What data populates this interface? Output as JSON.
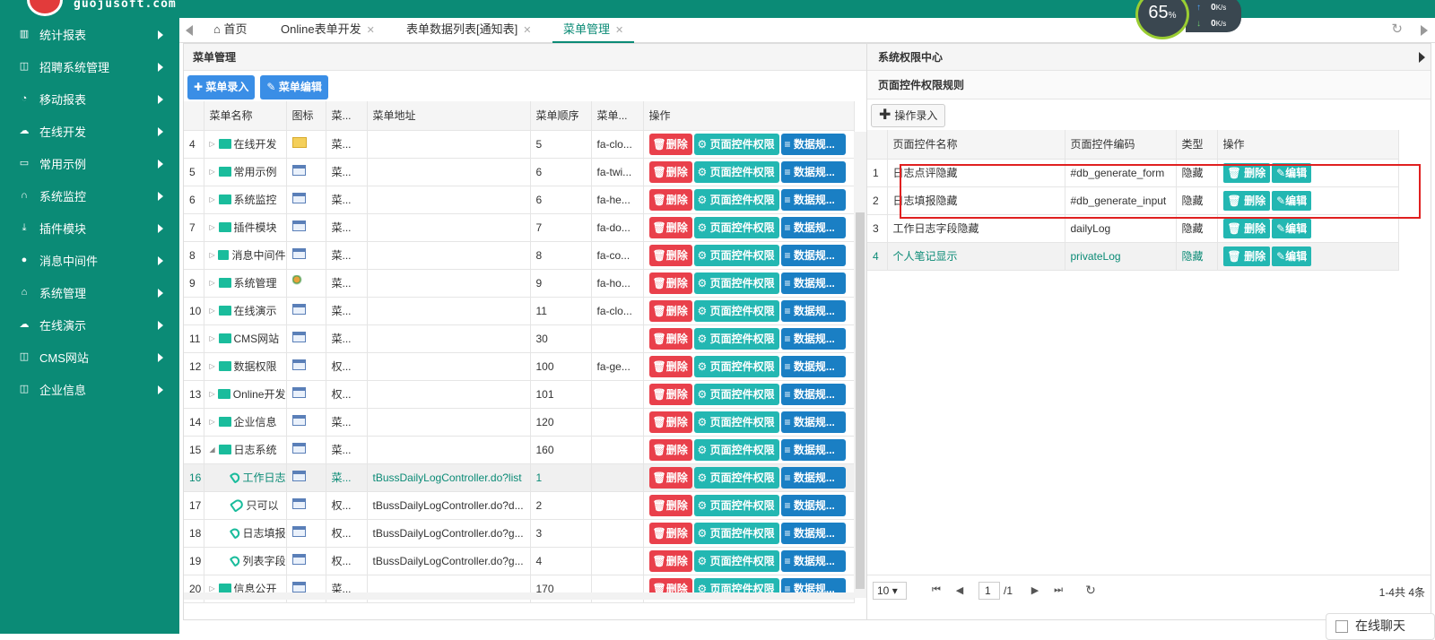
{
  "brand": {
    "logo_text": "guojusoft.com"
  },
  "sidebar": {
    "items": [
      {
        "label": "统计报表",
        "icon": "bar-chart-icon",
        "glyph": "▥"
      },
      {
        "label": "招聘系统管理",
        "icon": "columns-icon",
        "glyph": "◫"
      },
      {
        "label": "移动报表",
        "icon": "pie-chart-icon",
        "glyph": "◔"
      },
      {
        "label": "在线开发",
        "icon": "cloud-icon",
        "glyph": "☁"
      },
      {
        "label": "常用示例",
        "icon": "comment-icon",
        "glyph": "▭"
      },
      {
        "label": "系统监控",
        "icon": "headset-icon",
        "glyph": "∩"
      },
      {
        "label": "插件模块",
        "icon": "download-icon",
        "glyph": "⤓"
      },
      {
        "label": "消息中间件",
        "icon": "comments-icon",
        "glyph": "●"
      },
      {
        "label": "系统管理",
        "icon": "home-icon",
        "glyph": "⌂"
      },
      {
        "label": "在线演示",
        "icon": "cloud-icon",
        "glyph": "☁"
      },
      {
        "label": "CMS网站",
        "icon": "columns-icon",
        "glyph": "◫"
      },
      {
        "label": "企业信息",
        "icon": "columns-icon",
        "glyph": "◫"
      }
    ]
  },
  "monitor": {
    "percent": "65",
    "percent_unit": "%",
    "up_speed": "0",
    "down_speed": "0",
    "speed_unit": "K/s"
  },
  "tabs": [
    {
      "label": "首页",
      "closable": false
    },
    {
      "label": "Online表单开发",
      "closable": true
    },
    {
      "label": "表单数据列表[通知表]",
      "closable": true
    },
    {
      "label": "菜单管理",
      "closable": true,
      "active": true
    }
  ],
  "left_panel": {
    "title": "菜单管理",
    "add_button": "菜单录入",
    "edit_button": "菜单编辑",
    "columns": [
      "菜单名称",
      "图标",
      "菜...",
      "菜单地址",
      "菜单顺序",
      "菜单...",
      "操作"
    ],
    "delete_label": "删除",
    "perm_label": "页面控件权限",
    "data_label": "数据规...",
    "rows": [
      {
        "no": "4",
        "name": "在线开发",
        "level": 0,
        "expanded": false,
        "icon": "folder",
        "type": "菜...",
        "url": "",
        "order": "5",
        "fa": "fa-clo..."
      },
      {
        "no": "5",
        "name": "常用示例",
        "level": 0,
        "expanded": false,
        "icon": "grid",
        "type": "菜...",
        "url": "",
        "order": "6",
        "fa": "fa-twi..."
      },
      {
        "no": "6",
        "name": "系统监控",
        "level": 0,
        "expanded": false,
        "icon": "grid",
        "type": "菜...",
        "url": "",
        "order": "6",
        "fa": "fa-he..."
      },
      {
        "no": "7",
        "name": "插件模块",
        "level": 0,
        "expanded": false,
        "icon": "grid",
        "type": "菜...",
        "url": "",
        "order": "7",
        "fa": "fa-do..."
      },
      {
        "no": "8",
        "name": "消息中间件",
        "level": 0,
        "expanded": false,
        "icon": "grid",
        "type": "菜...",
        "url": "",
        "order": "8",
        "fa": "fa-co..."
      },
      {
        "no": "9",
        "name": "系统管理",
        "level": 0,
        "expanded": false,
        "icon": "users",
        "type": "菜...",
        "url": "",
        "order": "9",
        "fa": "fa-ho..."
      },
      {
        "no": "10",
        "name": "在线演示",
        "level": 0,
        "expanded": false,
        "icon": "grid",
        "type": "菜...",
        "url": "",
        "order": "11",
        "fa": "fa-clo..."
      },
      {
        "no": "11",
        "name": "CMS网站",
        "level": 0,
        "expanded": false,
        "icon": "grid",
        "type": "菜...",
        "url": "",
        "order": "30",
        "fa": ""
      },
      {
        "no": "12",
        "name": "数据权限",
        "level": 0,
        "expanded": false,
        "icon": "grid",
        "type": "权...",
        "url": "",
        "order": "100",
        "fa": "fa-ge..."
      },
      {
        "no": "13",
        "name": "Online开发",
        "level": 0,
        "expanded": false,
        "icon": "grid",
        "type": "权...",
        "url": "",
        "order": "101",
        "fa": ""
      },
      {
        "no": "14",
        "name": "企业信息",
        "level": 0,
        "expanded": false,
        "icon": "grid",
        "type": "菜...",
        "url": "",
        "order": "120",
        "fa": ""
      },
      {
        "no": "15",
        "name": "日志系统",
        "level": 0,
        "expanded": true,
        "icon": "grid",
        "type": "菜...",
        "url": "",
        "order": "160",
        "fa": ""
      },
      {
        "no": "16",
        "name": "工作日志",
        "level": 1,
        "expanded": false,
        "icon": "grid",
        "type": "菜...",
        "url": "tBussDailyLogController.do?list",
        "order": "1",
        "fa": "",
        "selected": true
      },
      {
        "no": "17",
        "name": "只可以",
        "level": 1,
        "expanded": false,
        "icon": "grid",
        "type": "权...",
        "url": "tBussDailyLogController.do?d...",
        "order": "2",
        "fa": ""
      },
      {
        "no": "18",
        "name": "日志填报",
        "level": 1,
        "expanded": false,
        "icon": "grid",
        "type": "权...",
        "url": "tBussDailyLogController.do?g...",
        "order": "3",
        "fa": ""
      },
      {
        "no": "19",
        "name": "列表字段",
        "level": 1,
        "expanded": false,
        "icon": "grid",
        "type": "权...",
        "url": "tBussDailyLogController.do?g...",
        "order": "4",
        "fa": ""
      },
      {
        "no": "20",
        "name": "信息公开",
        "level": 0,
        "expanded": false,
        "icon": "grid",
        "type": "菜...",
        "url": "",
        "order": "170",
        "fa": ""
      }
    ]
  },
  "right_panel": {
    "title": "系统权限中心",
    "subtitle": "页面控件权限规则",
    "add_button": "操作录入",
    "columns": [
      "页面控件名称",
      "页面控件编码",
      "类型",
      "操作"
    ],
    "delete_label": "删除",
    "edit_label": "编辑",
    "rows": [
      {
        "no": "1",
        "name": "日志点评隐藏",
        "code": "#db_generate_form",
        "type": "隐藏"
      },
      {
        "no": "2",
        "name": "日志填报隐藏",
        "code": "#db_generate_input",
        "type": "隐藏"
      },
      {
        "no": "3",
        "name": "工作日志字段隐藏",
        "code": "dailyLog",
        "type": "隐藏"
      },
      {
        "no": "4",
        "name": "个人笔记显示",
        "code": "privateLog",
        "type": "隐藏",
        "highlight": true
      }
    ],
    "pager": {
      "page_size": "10",
      "current_page": "1",
      "total_pages_label": "/1",
      "summary": "1-4共 4条"
    }
  },
  "chat": {
    "label": "在线聊天"
  }
}
